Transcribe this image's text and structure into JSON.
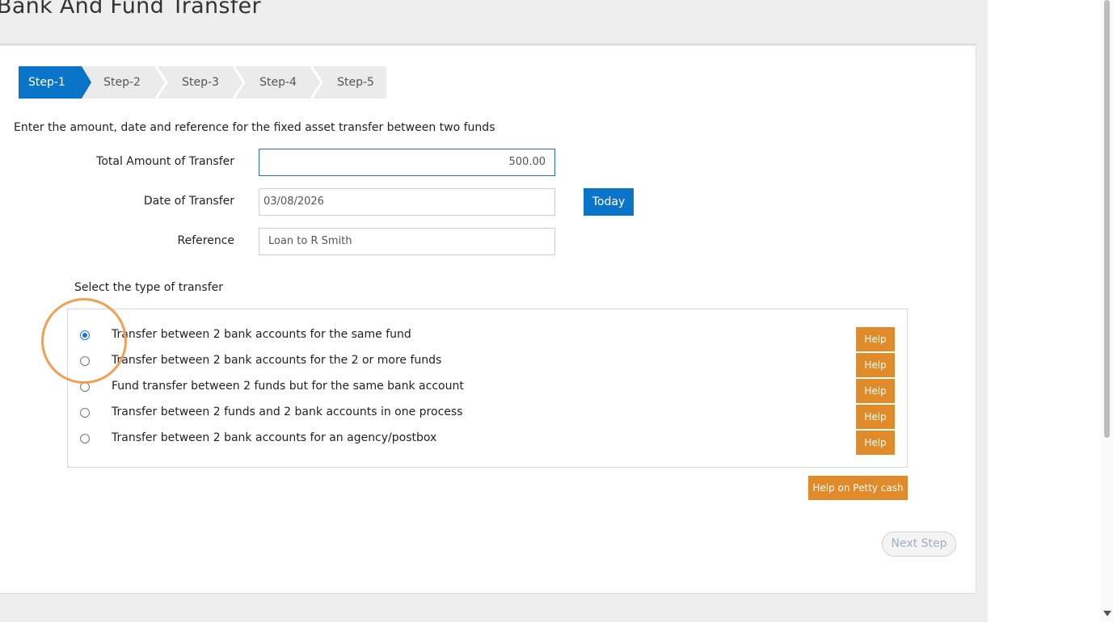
{
  "page": {
    "title": "Bank And Fund Transfer"
  },
  "stepper": {
    "steps": [
      {
        "label": "Step-1",
        "active": true
      },
      {
        "label": "Step-2",
        "active": false
      },
      {
        "label": "Step-3",
        "active": false
      },
      {
        "label": "Step-4",
        "active": false
      },
      {
        "label": "Step-5",
        "active": false
      }
    ]
  },
  "form": {
    "instruction": "Enter the amount, date and reference for the fixed asset transfer between two funds",
    "amount": {
      "label": "Total Amount of Transfer",
      "value": "500.00"
    },
    "date": {
      "label": "Date of Transfer",
      "value": "03/08/2026",
      "today_label": "Today"
    },
    "reference": {
      "label": "Reference",
      "value": "Loan to R Smith"
    }
  },
  "transfer_type": {
    "label": "Select the type of transfer",
    "options": [
      {
        "label": "Transfer between 2 bank accounts for the same fund",
        "checked": true
      },
      {
        "label": "Transfer between 2 bank accounts for the 2 or more funds",
        "checked": false
      },
      {
        "label": "Fund transfer between 2 funds but for the same bank account",
        "checked": false
      },
      {
        "label": "Transfer between 2 funds and 2 bank accounts in one process",
        "checked": false
      },
      {
        "label": "Transfer between 2 bank accounts for an agency/postbox",
        "checked": false
      }
    ],
    "help_label": "Help",
    "help_petty_label": "Help on Petty cash"
  },
  "actions": {
    "next_label": "Next Step"
  },
  "colors": {
    "primary": "#0a74c9",
    "help": "#e08a2a",
    "highlight": "#f0a050",
    "step_inactive": "#ebebeb"
  }
}
